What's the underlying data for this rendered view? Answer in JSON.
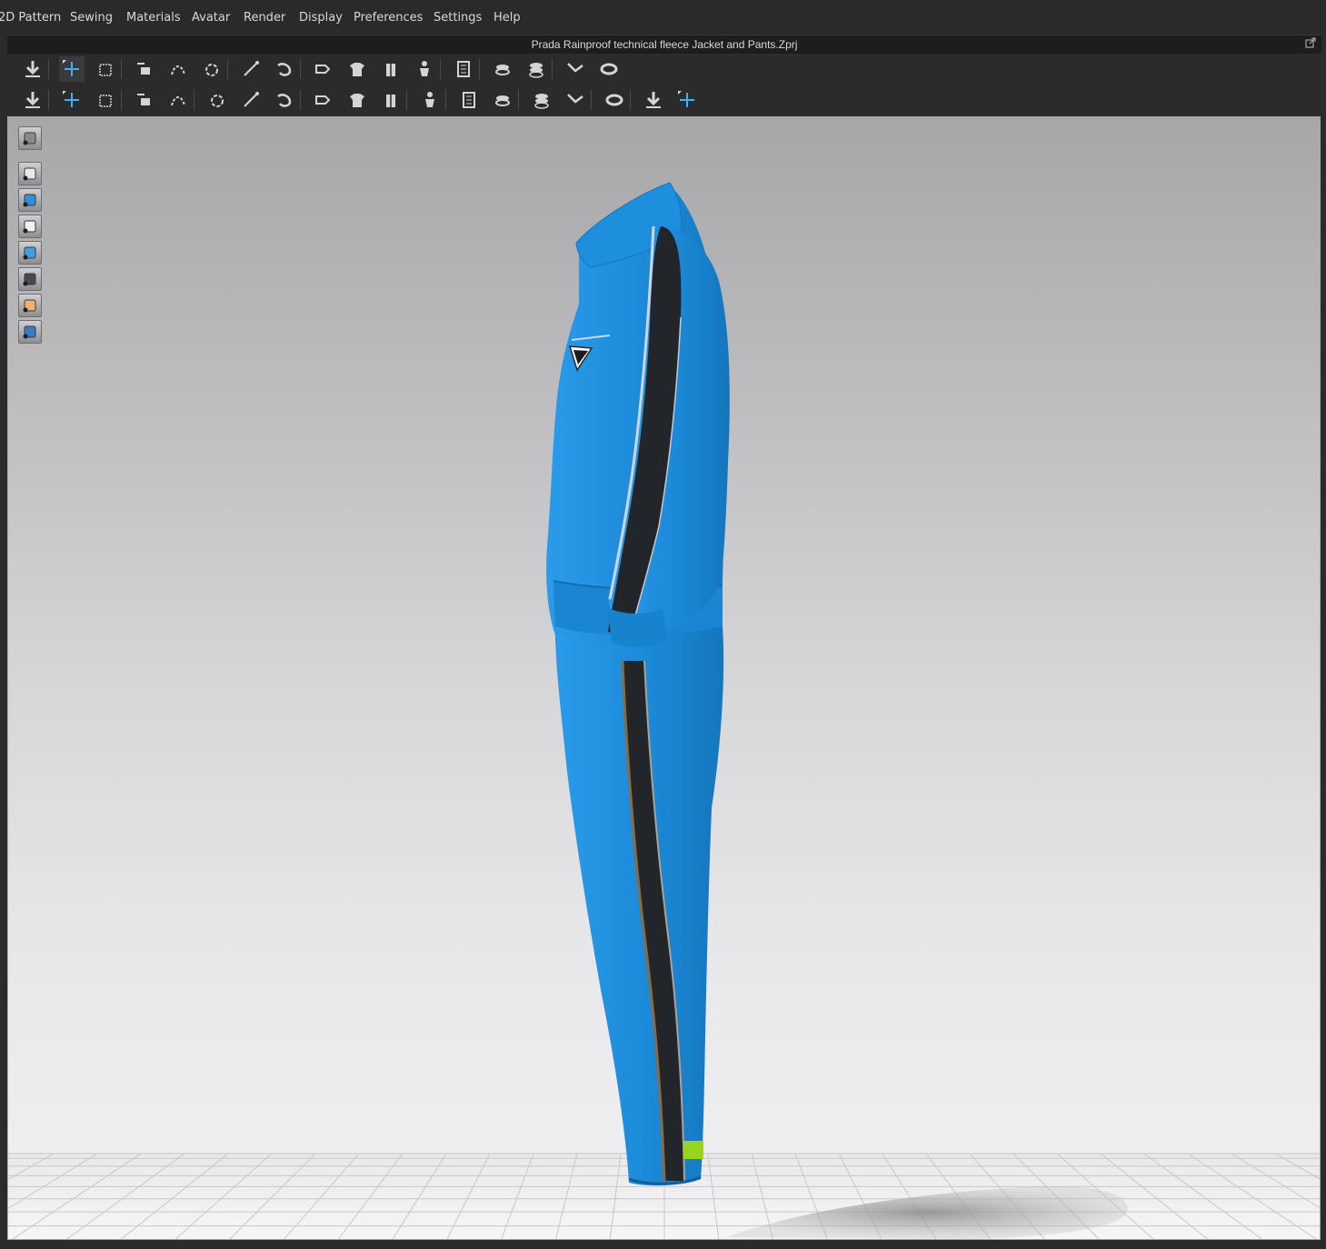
{
  "menu": [
    "2D Pattern",
    "Sewing",
    "Materials",
    "Avatar",
    "Render",
    "Display",
    "Preferences",
    "Settings",
    "Help"
  ],
  "window": {
    "title": "Prada Rainproof technical fleece Jacket and Pants.Zprj"
  },
  "toolbar1": [
    {
      "icon": "simulate-icon"
    },
    {
      "icon": "select-move-icon",
      "active": true
    },
    {
      "icon": "box-select-icon"
    },
    {
      "icon": "transform-pattern-icon"
    },
    {
      "icon": "edit-pattern-icon"
    },
    {
      "icon": "rotate-pattern-icon"
    },
    {
      "icon": "pin-icon"
    },
    {
      "icon": "fold-icon"
    },
    {
      "icon": "arrangement-icon"
    },
    {
      "icon": "garment-fit-icon"
    },
    {
      "icon": "shirt-icon"
    },
    {
      "icon": "avatar-icon"
    },
    {
      "icon": "measure-icon"
    },
    {
      "icon": "layer-icon"
    },
    {
      "icon": "stack-icon"
    },
    {
      "icon": "tape-icon"
    },
    {
      "icon": "ring-icon"
    }
  ],
  "toolbar2": [
    {
      "icon": "pose-icon"
    },
    {
      "icon": "trim-select-icon"
    },
    {
      "icon": "trim-add-icon"
    },
    {
      "icon": "line-edit-icon"
    },
    {
      "icon": "line-delete-icon"
    },
    {
      "icon": "topstitch-icon"
    },
    {
      "icon": "puckering-icon"
    },
    {
      "icon": "pattern-icon"
    },
    {
      "icon": "button-icon"
    },
    {
      "icon": "button-add-icon"
    },
    {
      "icon": "buttonhole-icon"
    },
    {
      "icon": "zipper-icon"
    },
    {
      "icon": "texture-icon"
    },
    {
      "icon": "texture-apply-icon"
    },
    {
      "icon": "graphic-icon"
    },
    {
      "icon": "graphic-apply-icon"
    },
    {
      "icon": "align-icon"
    },
    {
      "icon": "fold-arrange-icon"
    },
    {
      "icon": "fold-arrange-alt-icon"
    }
  ],
  "side_toolbar": [
    {
      "icon": "view-cube-icon"
    },
    {
      "icon": "show-garment-icon"
    },
    {
      "icon": "show-pattern-icon"
    },
    {
      "icon": "show-avatar-icon"
    },
    {
      "icon": "show-texture-icon"
    },
    {
      "icon": "show-surface-icon"
    },
    {
      "icon": "show-skin-icon"
    },
    {
      "icon": "show-environment-icon"
    }
  ],
  "colors": {
    "garment": "#1f8fde",
    "stripe": "#22262b",
    "piping": "#c9c9c9",
    "pants_piping": "#8c6a3e",
    "cuff_tag": "#9ad320",
    "shadow": "#9a9a9c"
  }
}
